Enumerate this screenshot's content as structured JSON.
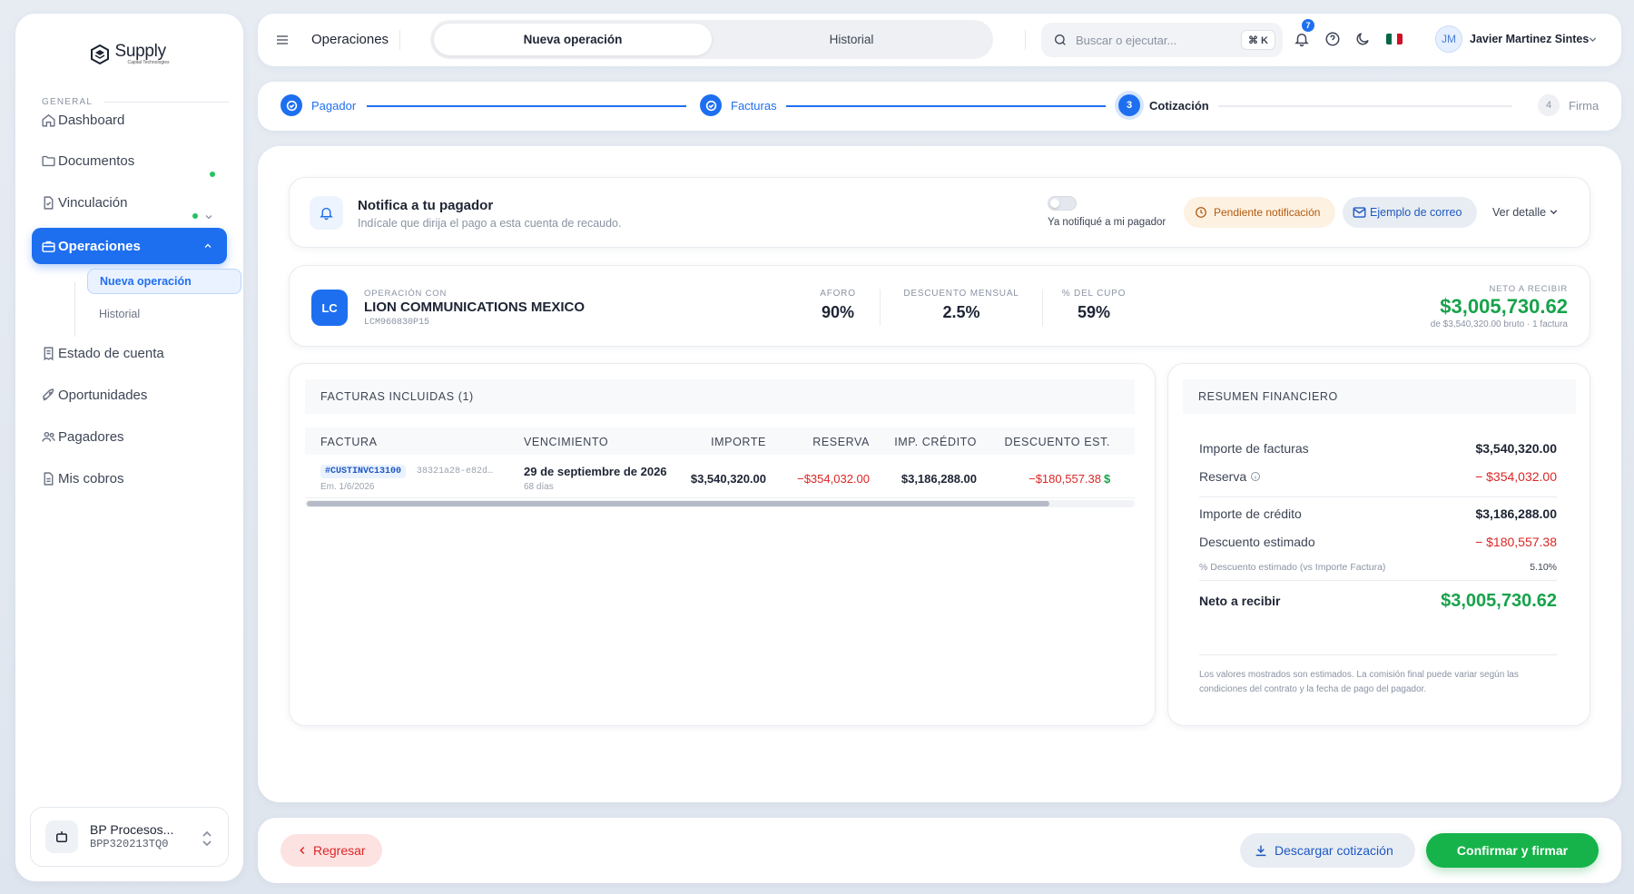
{
  "app": {
    "brand": "Supply",
    "brand_sub": "Capital Technologies"
  },
  "sidebar": {
    "section": "GENERAL",
    "items": [
      {
        "label": "Dashboard",
        "icon": "home-icon"
      },
      {
        "label": "Documentos",
        "icon": "folder-icon"
      },
      {
        "label": "Vinculación",
        "icon": "file-check-icon"
      },
      {
        "label": "Operaciones",
        "icon": "briefcase-icon"
      },
      {
        "label": "Estado de cuenta",
        "icon": "receipt-icon"
      },
      {
        "label": "Oportunidades",
        "icon": "rocket-icon"
      },
      {
        "label": "Pagadores",
        "icon": "users-icon"
      },
      {
        "label": "Mis cobros",
        "icon": "document-icon"
      }
    ],
    "sub_items": [
      {
        "label": "Nueva operación"
      },
      {
        "label": "Historial"
      }
    ],
    "account": {
      "name": "BP Procesos...",
      "rfc": "BPP320213TQ0"
    }
  },
  "topbar": {
    "title": "Operaciones",
    "tabs": [
      {
        "label": "Nueva operación"
      },
      {
        "label": "Historial"
      }
    ],
    "search_placeholder": "Buscar o ejecutar...",
    "shortcut": "⌘ K",
    "notification_count": "7",
    "user_initials": "JM",
    "user_name": "Javier Martinez Sintes"
  },
  "stepper": {
    "steps": [
      {
        "num": "1",
        "label": "Pagador",
        "state": "done"
      },
      {
        "num": "2",
        "label": "Facturas",
        "state": "done"
      },
      {
        "num": "3",
        "label": "Cotización",
        "state": "current"
      },
      {
        "num": "4",
        "label": "Firma",
        "state": "todo"
      }
    ]
  },
  "notify": {
    "title": "Notifica a tu pagador",
    "subtitle": "Indícale que dirija el pago a esta cuenta de recaudo.",
    "toggle_label": "Ya notifiqué a mi pagador",
    "status": "Pendiente notificación",
    "email_example": "Ejemplo de correo",
    "details": "Ver detalle"
  },
  "operation": {
    "initials": "LC",
    "label": "OPERACIÓN CON",
    "company": "LION COMMUNICATIONS MEXICO",
    "rfc": "LCM960830P15",
    "metrics": [
      {
        "label": "AFORO",
        "value": "90%"
      },
      {
        "label": "DESCUENTO MENSUAL",
        "value": "2.5%"
      },
      {
        "label": "% DEL CUPO",
        "value": "59%"
      }
    ],
    "net_label": "NETO A RECIBIR",
    "net_value": "$3,005,730.62",
    "net_sub": "de $3,540,320.00 bruto · 1 factura"
  },
  "invoices": {
    "title": "FACTURAS INCLUIDAS (1)",
    "columns": [
      "FACTURA",
      "VENCIMIENTO",
      "IMPORTE",
      "RESERVA",
      "IMP. CRÉDITO",
      "DESCUENTO EST."
    ],
    "rows": [
      {
        "id": "#CUSTINVC13100",
        "hash": "38321a28-e82d…",
        "emitted": "Em. 1/6/2026",
        "due": "29 de septiembre de 2026",
        "days": "68 días",
        "importe": "$3,540,320.00",
        "reserva": "−$354,032.00",
        "credito": "$3,186,288.00",
        "descuento": "−$180,557.38",
        "neto_partial": "$"
      }
    ],
    "scroll_position": 0,
    "scroll_visible_fraction": 0.9
  },
  "summary": {
    "title": "RESUMEN FINANCIERO",
    "rows": [
      {
        "label": "Importe de facturas",
        "value": "$3,540,320.00"
      },
      {
        "label": "Reserva",
        "value": "− $354,032.00"
      },
      {
        "label": "Importe de crédito",
        "value": "$3,186,288.00"
      },
      {
        "label": "Descuento estimado",
        "value": "− $180,557.38"
      },
      {
        "label": "% Descuento estimado (vs Importe Factura)",
        "value": "5.10%"
      },
      {
        "label": "Neto a recibir",
        "value": "$3,005,730.62"
      }
    ],
    "note": "Los valores mostrados son estimados. La comisión final puede variar según las condiciones del contrato y la fecha de pago del pagador."
  },
  "footer": {
    "back": "Regresar",
    "download": "Descargar cotización",
    "confirm": "Confirmar y firmar"
  },
  "colors": {
    "accent": "#1e6ff0",
    "success": "#16a34a",
    "danger": "#dc2626",
    "warning": "#b45a0c"
  }
}
